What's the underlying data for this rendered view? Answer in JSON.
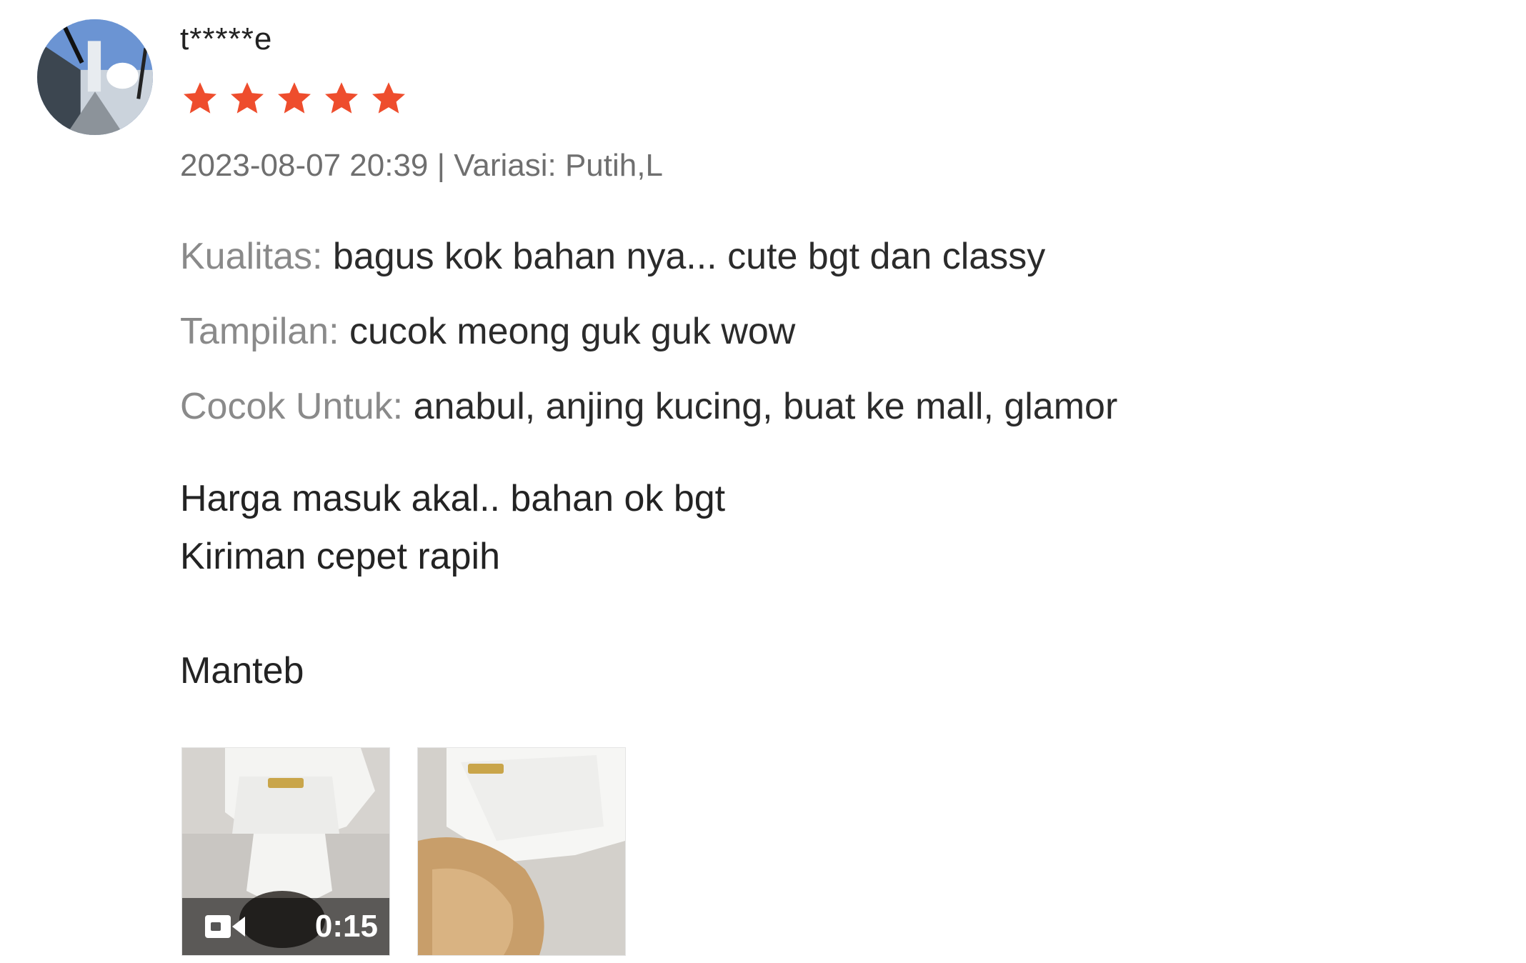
{
  "review": {
    "username": "t*****e",
    "rating": 5,
    "meta": "2023-08-07 20:39 | Variasi: Putih,L",
    "attributes": [
      {
        "label": "Kualitas:",
        "value": "bagus kok bahan nya... cute bgt dan classy"
      },
      {
        "label": "Tampilan:",
        "value": "cucok meong guk guk wow"
      },
      {
        "label": "Cocok Untuk:",
        "value": "anabul, anjing kucing, buat ke mall, glamor"
      }
    ],
    "comment_lines": [
      "Harga masuk akal.. bahan ok bgt",
      "Kiriman cepet rapih",
      "Manteb"
    ],
    "media": [
      {
        "type": "video",
        "duration": "0:15"
      },
      {
        "type": "image"
      }
    ]
  },
  "colors": {
    "star": "#ee4d2d",
    "label": "#8a8a8a",
    "text": "#222222"
  },
  "icons": {
    "star": "star-icon",
    "video": "video-camera-icon"
  }
}
